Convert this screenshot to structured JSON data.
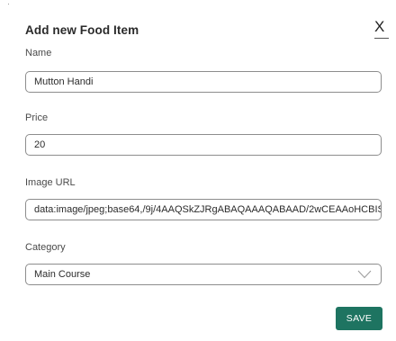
{
  "dialog": {
    "title": "Add new Food Item",
    "close_label": "X"
  },
  "form": {
    "name": {
      "label": "Name",
      "value": "Mutton Handi"
    },
    "price": {
      "label": "Price",
      "value": "20"
    },
    "image_url": {
      "label": "Image URL",
      "value": "data:image/jpeg;base64,/9j/4AAQSkZJRgABAQAAAQABAAD/2wCEAAoHCBIS"
    },
    "category": {
      "label": "Category",
      "value": "Main Course"
    }
  },
  "actions": {
    "save_label": "SAVE"
  },
  "colors": {
    "save_button": "#1e7461",
    "field_border": "#8d8d8d"
  },
  "icons": {
    "close": "close-icon",
    "dropdown": "chevron-down-icon"
  }
}
